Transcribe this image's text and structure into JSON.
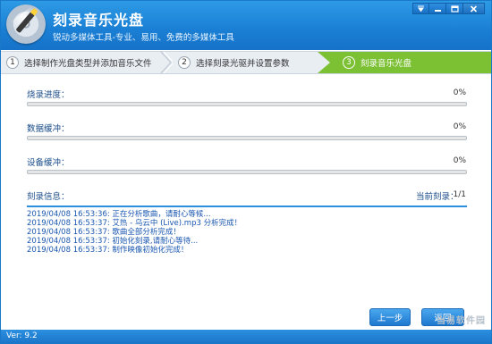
{
  "window": {
    "title": "刻录音乐光盘",
    "subtitle": "锐动多媒体工具-专业、易用、免费的多媒体工具",
    "controls": [
      "pin",
      "minimize",
      "maximize",
      "close"
    ]
  },
  "steps": [
    {
      "num": "1",
      "label": "选择制作光盘类型并添加音乐文件",
      "active": false
    },
    {
      "num": "2",
      "label": "选择刻录光驱并设置参数",
      "active": false
    },
    {
      "num": "3",
      "label": "刻录音乐光盘",
      "active": true
    }
  ],
  "progress": {
    "burn": {
      "label": "烧录进度：",
      "value_text": "0%",
      "value": 0
    },
    "data_buffer": {
      "label": "数据缓冲：",
      "value_text": "0%",
      "value": 0
    },
    "device_buffer": {
      "label": "设备缓冲：",
      "value_text": "0%",
      "value": 0
    }
  },
  "info": {
    "label": "刻录信息：",
    "current_label": "当前刻录：",
    "current_value": "1/1"
  },
  "log": [
    "2019/04/08 16:53:36:  正在分析歌曲，请耐心等候...",
    "2019/04/08 16:53:37:  艾热 - 乌云中 (Live).mp3 分析完成！",
    "2019/04/08 16:53:37:  歌曲全部分析完成！",
    "2019/04/08 16:53:37:  初始化刻录,请耐心等待...",
    "2019/04/08 16:53:37:  制作映像初始化完成！"
  ],
  "buttons": {
    "prev": "上一步",
    "back": "返回"
  },
  "status": {
    "version": "Ver: 9.2"
  },
  "watermark": "当易软件园",
  "colors": {
    "header": "#1a7fd4",
    "active_step": "#7cc034",
    "label_text": "#1b4d8a",
    "log_text": "#1a57b0",
    "accent": "#2b8fe0"
  }
}
